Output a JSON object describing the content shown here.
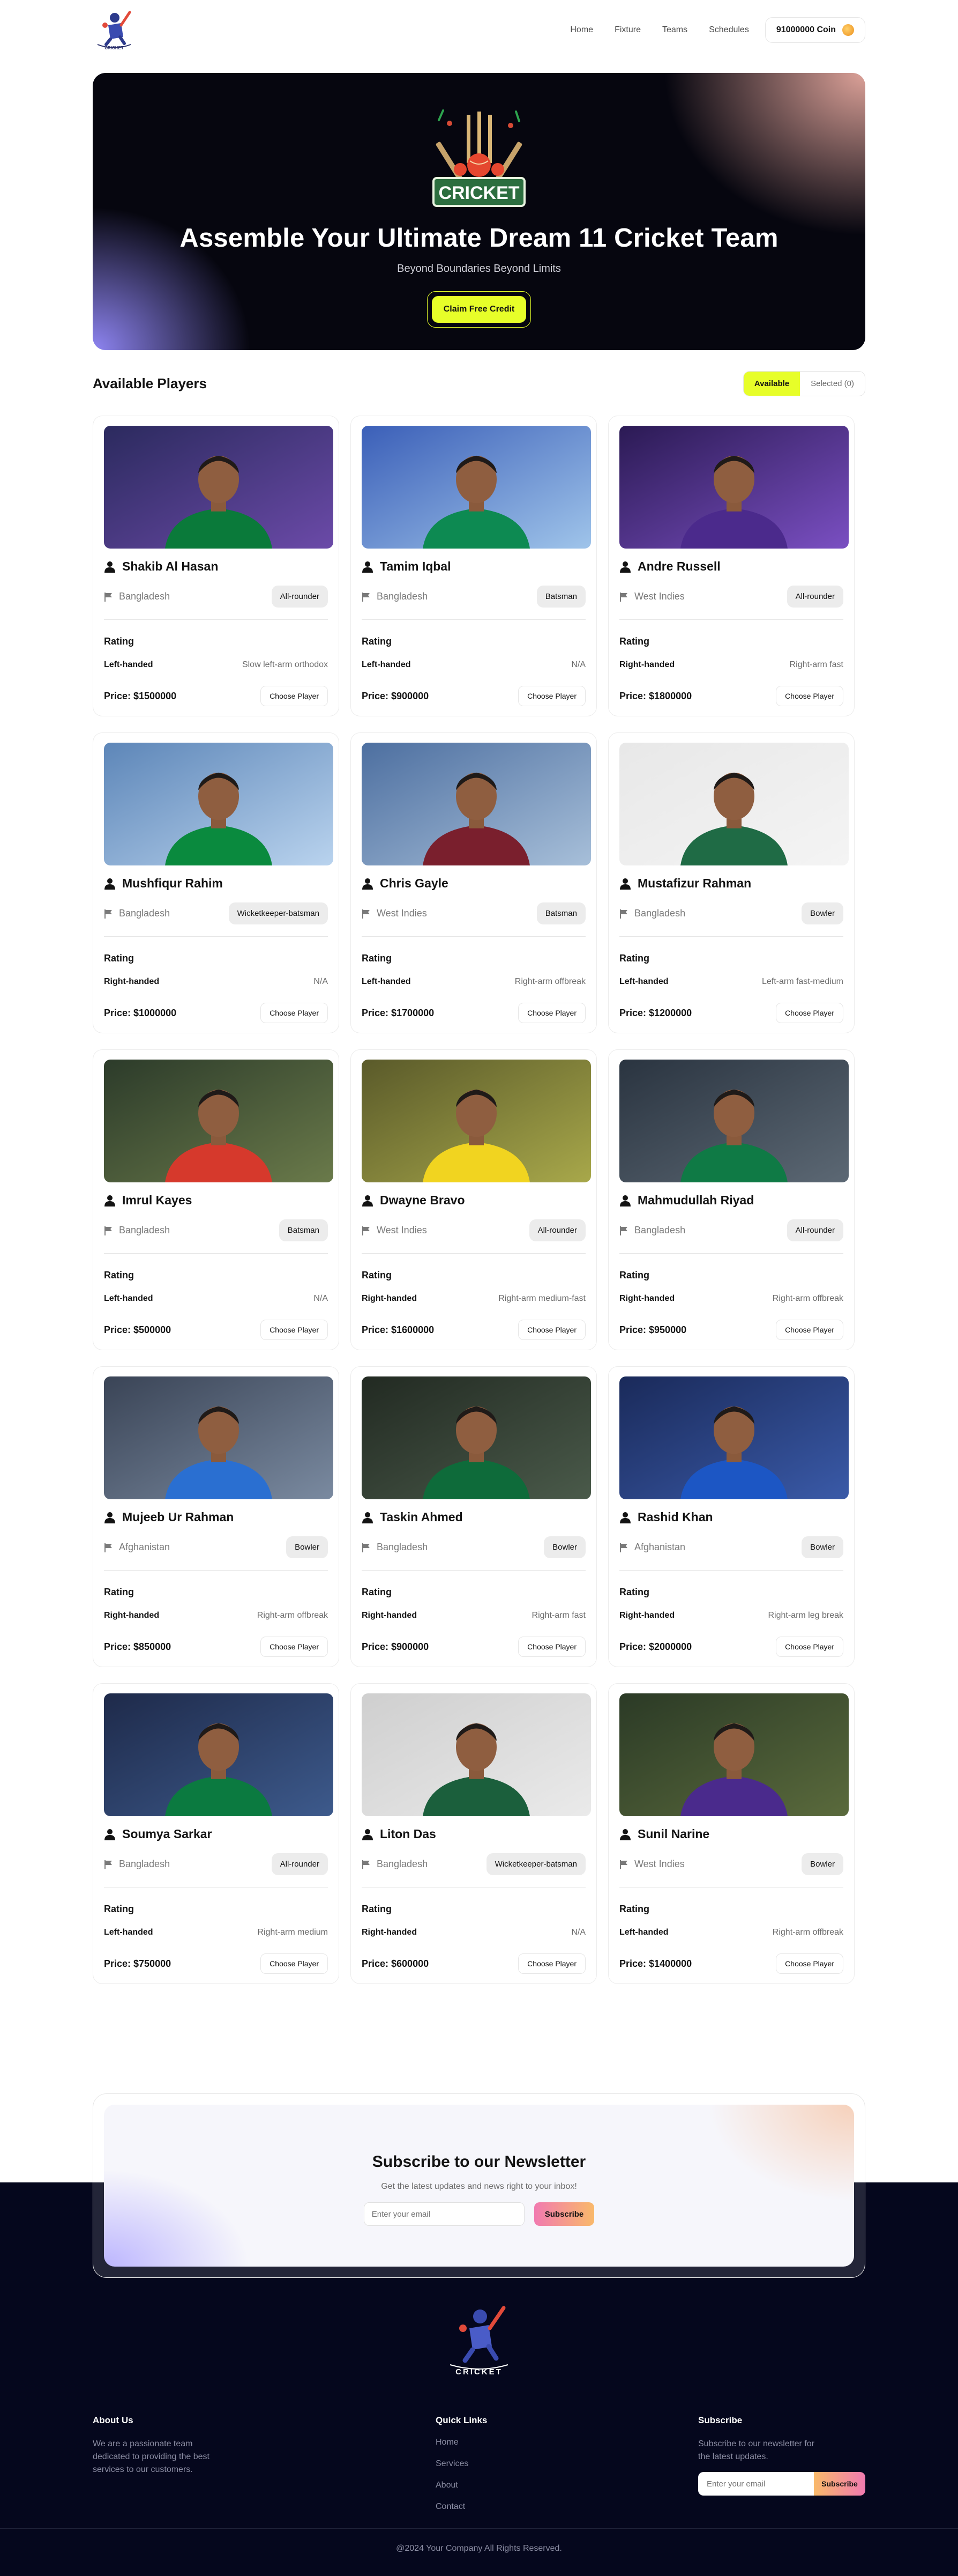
{
  "nav": {
    "links": [
      "Home",
      "Fixture",
      "Teams",
      "Schedules"
    ],
    "coin_amount": "91000000",
    "coin_label": "Coin"
  },
  "hero": {
    "logo_text": "CRICKET",
    "title": "Assemble Your Ultimate Dream 11 Cricket Team",
    "subtitle": "Beyond Boundaries Beyond Limits",
    "cta_label": "Claim Free Credit"
  },
  "players_section": {
    "title": "Available Players",
    "toggle_available": "Available",
    "toggle_selected": "Selected (0)"
  },
  "card_labels": {
    "rating": "Rating",
    "choose": "Choose Player"
  },
  "players": [
    {
      "name": "Shakib Al Hasan",
      "country": "Bangladesh",
      "role": "All-rounder",
      "batting": "Left-handed",
      "bowling": "Slow left-arm orthodox",
      "price": "Price: $1500000",
      "bg": [
        "#2b2a5e",
        "#6b4aa8"
      ],
      "jersey": "#0a7a3a"
    },
    {
      "name": "Tamim Iqbal",
      "country": "Bangladesh",
      "role": "Batsman",
      "batting": "Left-handed",
      "bowling": "N/A",
      "price": "Price: $900000",
      "bg": [
        "#3b5fb8",
        "#9fc4ea"
      ],
      "jersey": "#0d8a52"
    },
    {
      "name": "Andre Russell",
      "country": "West Indies",
      "role": "All-rounder",
      "batting": "Right-handed",
      "bowling": "Right-arm fast",
      "price": "Price: $1800000",
      "bg": [
        "#2b1a54",
        "#7a4fc2"
      ],
      "jersey": "#4b2a8c"
    },
    {
      "name": "Mushfiqur Rahim",
      "country": "Bangladesh",
      "role": "Wicketkeeper-batsman",
      "batting": "Right-handed",
      "bowling": "N/A",
      "price": "Price: $1000000",
      "bg": [
        "#5d86b8",
        "#b9d3ee"
      ],
      "jersey": "#0a8a3e"
    },
    {
      "name": "Chris Gayle",
      "country": "West Indies",
      "role": "Batsman",
      "batting": "Left-handed",
      "bowling": "Right-arm offbreak",
      "price": "Price: $1700000",
      "bg": [
        "#4d6fa0",
        "#a7bfd9"
      ],
      "jersey": "#7a1f2d"
    },
    {
      "name": "Mustafizur Rahman",
      "country": "Bangladesh",
      "role": "Bowler",
      "batting": "Left-handed",
      "bowling": "Left-arm fast-medium",
      "price": "Price: $1200000",
      "bg": [
        "#e8e8e8",
        "#f4f4f4"
      ],
      "jersey": "#1f6b45"
    },
    {
      "name": "Imrul Kayes",
      "country": "Bangladesh",
      "role": "Batsman",
      "batting": "Left-handed",
      "bowling": "N/A",
      "price": "Price: $500000",
      "bg": [
        "#2c3b2a",
        "#6a7a4a"
      ],
      "jersey": "#d6392c"
    },
    {
      "name": "Dwayne Bravo",
      "country": "West Indies",
      "role": "All-rounder",
      "batting": "Right-handed",
      "bowling": "Right-arm medium-fast",
      "price": "Price: $1600000",
      "bg": [
        "#5a5a2a",
        "#a8a84a"
      ],
      "jersey": "#f1d420"
    },
    {
      "name": "Mahmudullah Riyad",
      "country": "Bangladesh",
      "role": "All-rounder",
      "batting": "Right-handed",
      "bowling": "Right-arm offbreak",
      "price": "Price: $950000",
      "bg": [
        "#2a3440",
        "#5c6874"
      ],
      "jersey": "#0f7a45"
    },
    {
      "name": "Mujeeb Ur Rahman",
      "country": "Afghanistan",
      "role": "Bowler",
      "batting": "Right-handed",
      "bowling": "Right-arm offbreak",
      "price": "Price: $850000",
      "bg": [
        "#3a4456",
        "#7a8aa0"
      ],
      "jersey": "#2a6fd1"
    },
    {
      "name": "Taskin Ahmed",
      "country": "Bangladesh",
      "role": "Bowler",
      "batting": "Right-handed",
      "bowling": "Right-arm fast",
      "price": "Price: $900000",
      "bg": [
        "#222a22",
        "#4a5a4a"
      ],
      "jersey": "#0e6b3a"
    },
    {
      "name": "Rashid Khan",
      "country": "Afghanistan",
      "role": "Bowler",
      "batting": "Right-handed",
      "bowling": "Right-arm leg break",
      "price": "Price: $2000000",
      "bg": [
        "#1a2a5a",
        "#3a5aa8"
      ],
      "jersey": "#1c56c4"
    },
    {
      "name": "Soumya Sarkar",
      "country": "Bangladesh",
      "role": "All-rounder",
      "batting": "Left-handed",
      "bowling": "Right-arm medium",
      "price": "Price: $750000",
      "bg": [
        "#1e2a4a",
        "#3d5a8c"
      ],
      "jersey": "#0b7a40"
    },
    {
      "name": "Liton Das",
      "country": "Bangladesh",
      "role": "Wicketkeeper-batsman",
      "batting": "Right-handed",
      "bowling": "N/A",
      "price": "Price: $600000",
      "bg": [
        "#cfcfcf",
        "#eaeaea"
      ],
      "jersey": "#1b5f3c"
    },
    {
      "name": "Sunil Narine",
      "country": "West Indies",
      "role": "Bowler",
      "batting": "Left-handed",
      "bowling": "Right-arm offbreak",
      "price": "Price: $1400000",
      "bg": [
        "#2b3a26",
        "#5a6a3c"
      ],
      "jersey": "#4a2a8c"
    }
  ],
  "newsletter": {
    "title": "Subscribe to our Newsletter",
    "subtitle": "Get the latest updates and news right to your inbox!",
    "placeholder": "Enter your email",
    "button": "Subscribe"
  },
  "footer": {
    "logo_text": "CRICKET",
    "about_title": "About Us",
    "about_text": "We are a passionate team dedicated to providing the best services to our customers.",
    "quick_title": "Quick Links",
    "quick_links": [
      "Home",
      "Services",
      "About",
      "Contact"
    ],
    "subscribe_title": "Subscribe",
    "subscribe_text": "Subscribe to our newsletter for the latest updates.",
    "placeholder": "Enter your email",
    "button": "Subscribe",
    "copyright": "@2024 Your Company All Rights Reserved."
  },
  "colors": {
    "accent": "#e7fe29",
    "dark": "#05071d"
  }
}
